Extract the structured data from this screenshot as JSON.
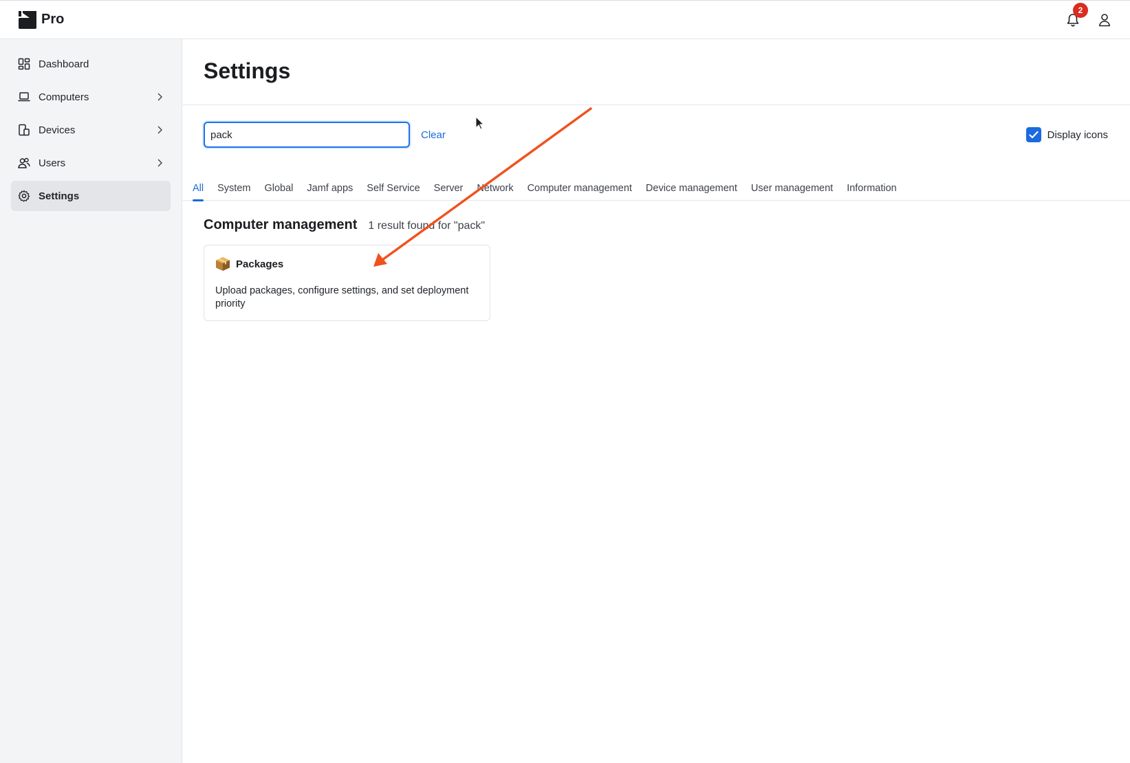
{
  "app": {
    "name": "Pro",
    "notification_count": "2"
  },
  "sidebar": {
    "items": [
      {
        "label": "Dashboard",
        "icon": "dashboard-icon"
      },
      {
        "label": "Computers",
        "icon": "laptop-icon"
      },
      {
        "label": "Devices",
        "icon": "devices-icon"
      },
      {
        "label": "Users",
        "icon": "users-icon"
      },
      {
        "label": "Settings",
        "icon": "gear-icon"
      }
    ],
    "active": "Settings"
  },
  "page": {
    "title": "Settings"
  },
  "search": {
    "value": "pack",
    "clear_label": "Clear"
  },
  "display_icons": {
    "label": "Display icons",
    "checked": true
  },
  "tabs": [
    "All",
    "System",
    "Global",
    "Jamf apps",
    "Self Service",
    "Server",
    "Network",
    "Computer management",
    "Device management",
    "User management",
    "Information"
  ],
  "results": {
    "section_title": "Computer management",
    "count_text": "1 result found for \"pack\"",
    "cards": [
      {
        "title": "Packages",
        "icon": "package-box-icon",
        "description": "Upload packages, configure settings, and set deployment priority"
      }
    ]
  },
  "colors": {
    "accent": "#1a6ad8",
    "badge": "#d92d20",
    "annotation_arrow": "#f0521e"
  }
}
